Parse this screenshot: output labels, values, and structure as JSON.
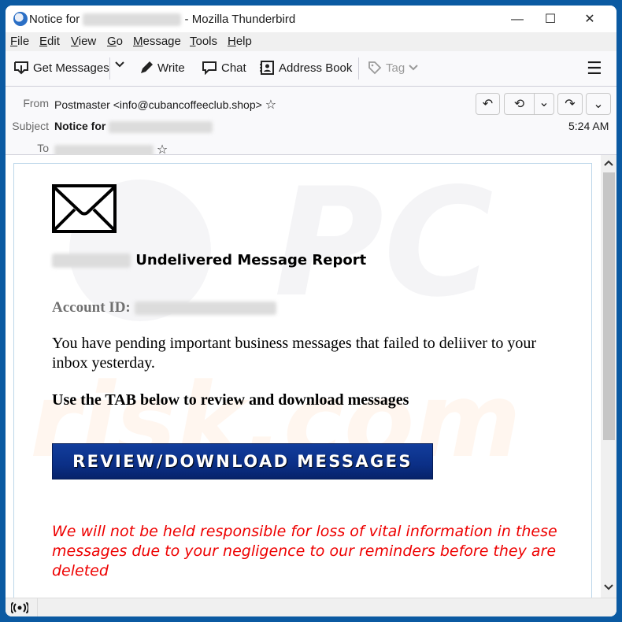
{
  "window": {
    "title_prefix": "Notice for",
    "title_suffix": "- Mozilla Thunderbird",
    "controls": {
      "minimize": "—",
      "maximize": "☐",
      "close": "✕"
    }
  },
  "menubar": [
    {
      "key": "F",
      "rest": "ile"
    },
    {
      "key": "E",
      "rest": "dit"
    },
    {
      "key": "V",
      "rest": "iew"
    },
    {
      "key": "G",
      "rest": "o"
    },
    {
      "key": "M",
      "rest": "essage"
    },
    {
      "key": "T",
      "rest": "ools"
    },
    {
      "key": "H",
      "rest": "elp"
    }
  ],
  "toolbar": {
    "get_messages": "Get Messages",
    "write": "Write",
    "chat": "Chat",
    "address_book": "Address Book",
    "tag": "Tag",
    "menu_icon": "☰"
  },
  "header": {
    "from_label": "From",
    "from_value": "Postmaster <info@cubancoffeeclub.shop>",
    "subject_label": "Subject",
    "subject_value": "Notice for",
    "to_label": "To",
    "time": "5:24 AM",
    "star": "☆",
    "buttons": {
      "reply": "↶",
      "reply_all": "⟲",
      "dropdown": "⌄",
      "forward": "↷",
      "more": "⌄"
    }
  },
  "message": {
    "report_title": "Undelivered Message Report",
    "account_label": "Account ID:",
    "paragraph": "You have pending important business messages that failed to deliiver to your inbox yesterday.",
    "instruction": "Use the TAB below to review and download messages",
    "cta_label": "REVIEW/DOWNLOAD MESSAGES",
    "warning": "We will not be held responsible for loss of vital information in these messages due to your negligence to our reminders before they are deleted",
    "watermark": "PC risk.com"
  },
  "colors": {
    "frame": "#0b5aa2",
    "cta": "#0b2f86",
    "warning": "#ee0000"
  }
}
